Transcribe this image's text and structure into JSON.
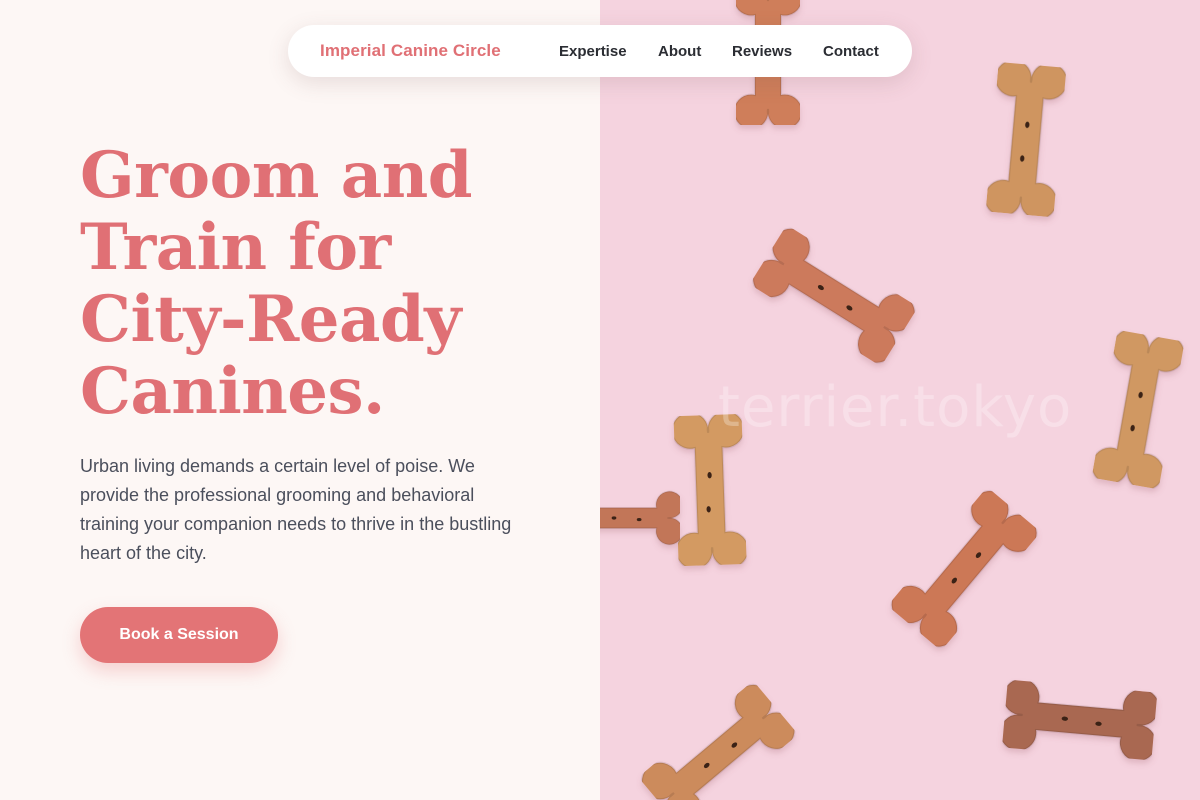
{
  "nav": {
    "brand": "Imperial Canine Circle",
    "links": [
      "Expertise",
      "About",
      "Reviews",
      "Contact"
    ]
  },
  "hero": {
    "title": "Groom and Train for City-Ready Canines.",
    "description": "Urban living demands a certain level of poise. We provide the professional grooming and behavioral training your companion needs to thrive in the bustling heart of the city.",
    "cta_label": "Book a Session"
  },
  "image": {
    "watermark": "terrier.tokyo",
    "background_color": "#f5d3df"
  },
  "colors": {
    "accent": "#e07075",
    "button": "#e37476",
    "page_background": "#fdf7f5",
    "text": "#4b4f5c"
  }
}
